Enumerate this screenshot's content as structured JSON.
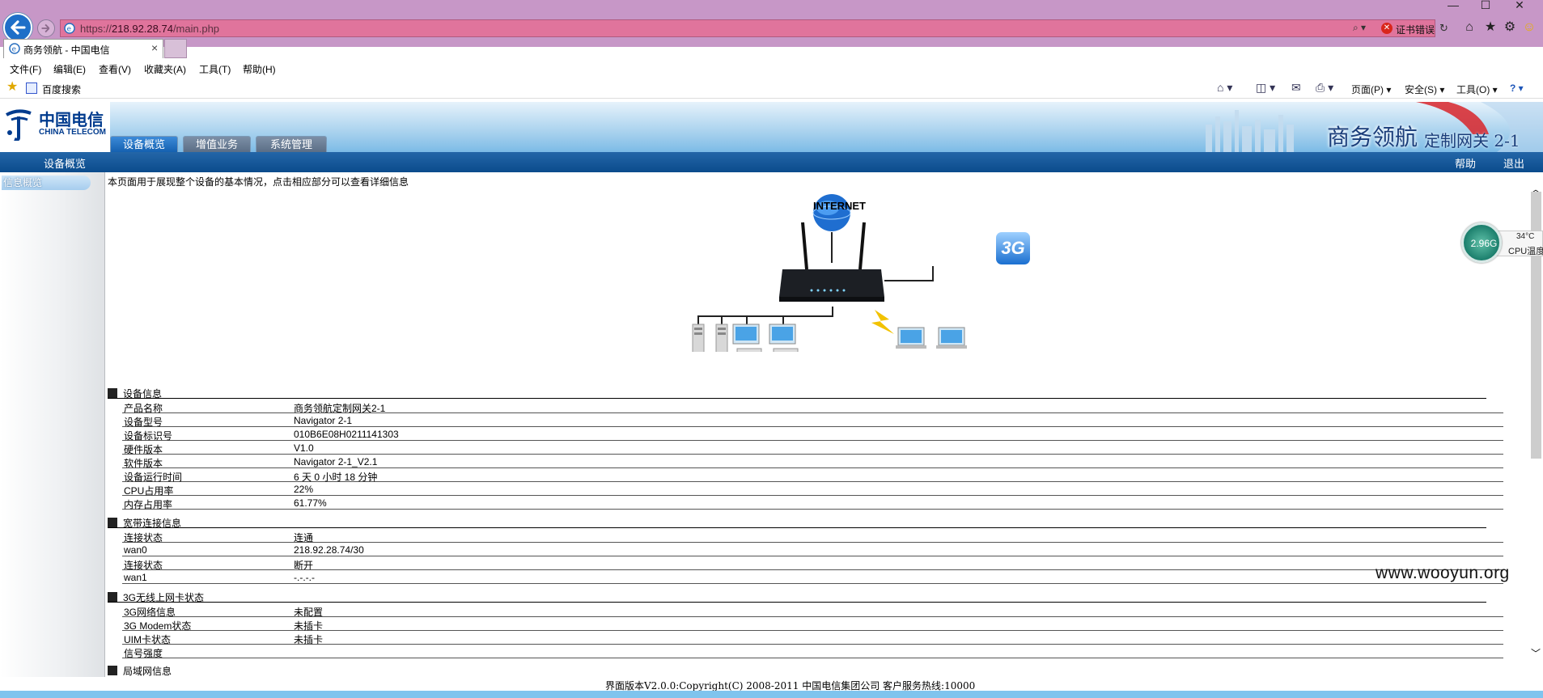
{
  "browser": {
    "url_prefix": "https://",
    "url_host": "218.92.28.74",
    "url_path": "/main.php",
    "cert_error": "证书错误",
    "tab_title": "商务领航 - 中国电信",
    "search_glyph": "⌕ ▾",
    "refresh_glyph": "↻",
    "window_controls": [
      "—",
      "☐",
      "✕"
    ],
    "toolbar_icons": [
      "home-icon",
      "star-icon",
      "gear-icon",
      "smiley-icon"
    ]
  },
  "menubar": {
    "items": [
      "文件(F)",
      "编辑(E)",
      "查看(V)",
      "收藏夹(A)",
      "工具(T)",
      "帮助(H)"
    ]
  },
  "favbar": {
    "baidu": "百度搜索",
    "page_menu": "页面(P) ▾",
    "safety_menu": "安全(S) ▾",
    "tools_menu": "工具(O) ▾",
    "help_icon": "? ▾"
  },
  "header": {
    "logo_cn": "中国电信",
    "logo_en": "CHINA TELECOM",
    "brand_title": "商务领航",
    "brand_sub": "定制网关 2-1",
    "tabs": [
      "设备概览",
      "增值业务",
      "系统管理"
    ]
  },
  "subnav": {
    "item": "设备概览",
    "help": "帮助",
    "logout": "退出"
  },
  "sidebar": {
    "item": "信息概览"
  },
  "content": {
    "intro": "本页面用于展现整个设备的基本情况，点击相应部分可以查看详细信息",
    "diagram": {
      "internet": "INTERNET",
      "label_3g": "3G"
    },
    "sections": [
      {
        "title": "设备信息",
        "rows": [
          {
            "k": "产品名称",
            "v": "商务领航定制网关2-1"
          },
          {
            "k": "设备型号",
            "v": "Navigator 2-1"
          },
          {
            "k": "设备标识号",
            "v": "010B6E08H0211141303"
          },
          {
            "k": "硬件版本",
            "v": "V1.0"
          },
          {
            "k": "软件版本",
            "v": "Navigator 2-1_V2.1"
          },
          {
            "k": "设备运行时间",
            "v": "6 天 0 小时 18 分钟"
          },
          {
            "k": "CPU占用率",
            "v": "22%"
          },
          {
            "k": "内存占用率",
            "v": "61.77%"
          }
        ]
      },
      {
        "title": "宽带连接信息",
        "rows": [
          {
            "k": "连接状态",
            "v": "连通"
          },
          {
            "k": "wan0",
            "v": "218.92.28.74/30"
          },
          {
            "k": "连接状态",
            "v": "断开"
          },
          {
            "k": "wan1",
            "v": "-.-.-.-"
          }
        ]
      },
      {
        "title": "3G无线上网卡状态",
        "rows": [
          {
            "k": "3G网络信息",
            "v": "未配置"
          },
          {
            "k": "3G Modem状态",
            "v": "未插卡"
          },
          {
            "k": "UIM卡状态",
            "v": "未插卡"
          },
          {
            "k": "信号强度",
            "v": ""
          }
        ]
      },
      {
        "title": "局域网信息",
        "rows": []
      }
    ]
  },
  "footer": "界面版本V2.0.0:Copyright(C) 2008-2011 中国电信集团公司 客户服务热线:10000",
  "watermark": "www.wooyun.org",
  "widget": {
    "speed": "2.96G",
    "temp": "34°C",
    "cpu": "CPU温度"
  },
  "scrollbar": {
    "up": "︿",
    "down": "﹀"
  }
}
